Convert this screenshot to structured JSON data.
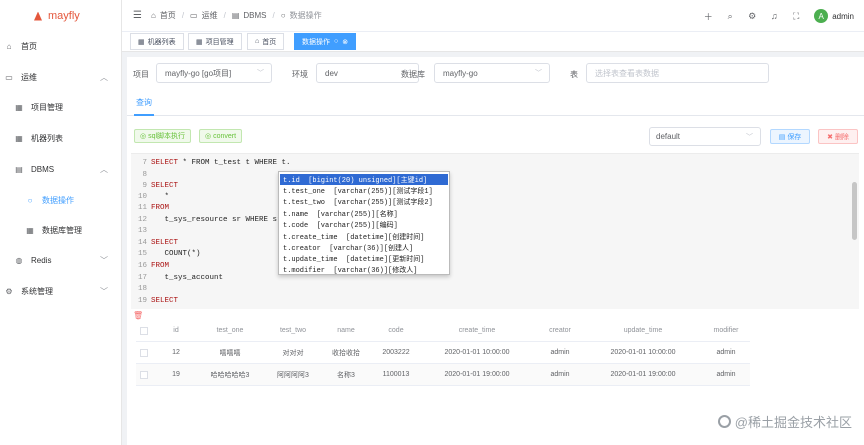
{
  "app": {
    "name": "mayfly"
  },
  "sidebar": {
    "items": [
      {
        "label": "首页",
        "icon": "home-icon",
        "glyph": "⌂"
      },
      {
        "label": "运维",
        "icon": "monitor-icon",
        "glyph": "▭",
        "arrow": "︿"
      },
      {
        "label": "项目管理",
        "icon": "grid-icon",
        "glyph": "▦"
      },
      {
        "label": "机器列表",
        "icon": "grid-icon",
        "glyph": "▦"
      },
      {
        "label": "DBMS",
        "icon": "database-icon",
        "glyph": "▤",
        "arrow": "︿"
      },
      {
        "label": "数据操作",
        "icon": "circle-icon",
        "glyph": "○"
      },
      {
        "label": "数据库管理",
        "icon": "grid-icon",
        "glyph": "▦"
      },
      {
        "label": "Redis",
        "icon": "redis-icon",
        "glyph": "◍",
        "arrow": "﹀"
      },
      {
        "label": "系统管理",
        "icon": "gear-icon",
        "glyph": "⚙",
        "arrow": "﹀"
      }
    ]
  },
  "header": {
    "menu_glyph": "☰",
    "breadcrumb": [
      {
        "label": "首页",
        "glyph": "⌂"
      },
      {
        "label": "运维",
        "glyph": "▭"
      },
      {
        "label": "DBMS",
        "glyph": "▤"
      },
      {
        "label": "数据操作",
        "glyph": "○"
      }
    ],
    "right_icons": [
      "＋",
      "⌕",
      "⚙",
      "♫",
      "⛶"
    ],
    "avatar_letter": "A",
    "username": "admin"
  },
  "tags": [
    {
      "label": "机器列表",
      "glyph": "▦"
    },
    {
      "label": "项目管理",
      "glyph": "▦"
    },
    {
      "label": "首页",
      "glyph": "⌂"
    },
    {
      "label": "数据操作",
      "glyph": "○",
      "close": "⊗"
    }
  ],
  "filters": {
    "project_label": "项目",
    "project_value": "mayfly-go [go项目]",
    "env_label": "环境",
    "env_value": "dev",
    "db_label": "数据库",
    "db_value": "mayfly-go",
    "table_label": "表",
    "table_placeholder": "选择表查看表数据"
  },
  "subtab": {
    "label": "查询"
  },
  "toolbar": {
    "run_label": "sql脚本执行",
    "convert_label": "convert",
    "saved_select": "default",
    "save_label": "保存",
    "delete_label": "删除"
  },
  "editor": {
    "lines": [
      {
        "n": "7",
        "kw": "SELECT",
        "tx": " * FROM t_test t WHERE t."
      },
      {
        "n": "8",
        "kw": "",
        "tx": ""
      },
      {
        "n": "9",
        "kw": "SELECT",
        "tx": ""
      },
      {
        "n": "10",
        "kw": "",
        "tx": "   *"
      },
      {
        "n": "11",
        "kw": "FROM",
        "tx": ""
      },
      {
        "n": "12",
        "kw": "",
        "tx": "   t_sys_resource sr WHERE sr."
      },
      {
        "n": "13",
        "kw": "",
        "tx": ""
      },
      {
        "n": "14",
        "kw": "SELECT",
        "tx": ""
      },
      {
        "n": "15",
        "kw": "",
        "tx": "   COUNT(*)"
      },
      {
        "n": "16",
        "kw": "FROM",
        "tx": ""
      },
      {
        "n": "17",
        "kw": "",
        "tx": "   t_sys_account"
      },
      {
        "n": "18",
        "kw": "",
        "tx": ""
      },
      {
        "n": "19",
        "kw": "SELECT",
        "tx": ""
      }
    ]
  },
  "autocomplete": [
    "t.id  [bigint(20) unsigned][主键id]",
    "t.test_one  [varchar(255)][测试字段1]",
    "t.test_two  [varchar(255)][测试字段2]",
    "t.name  [varchar(255)][名称]",
    "t.code  [varchar(255)][编码]",
    "t.create_time  [datetime][创建时间]",
    "t.creator  [varchar(36)][创建人]",
    "t.update_time  [datetime][更新时间]",
    "t.modifier  [varchar(36)][修改人]"
  ],
  "result": {
    "columns": [
      "id",
      "test_one",
      "test_two",
      "name",
      "code",
      "create_time",
      "creator",
      "update_time",
      "modifier"
    ],
    "rows": [
      [
        "12",
        "嘻嘻嘻",
        "对对对",
        "收拾收拾",
        "2003222",
        "2020-01-01 10:00:00",
        "admin",
        "2020-01-01 10:00:00",
        "admin"
      ],
      [
        "19",
        "哈哈哈哈哈3",
        "阿阿阿阿3",
        "名称3",
        "1100013",
        "2020-01-01 19:00:00",
        "admin",
        "2020-01-01 19:00:00",
        "admin"
      ]
    ]
  },
  "watermark": "@稀土掘金技术社区"
}
